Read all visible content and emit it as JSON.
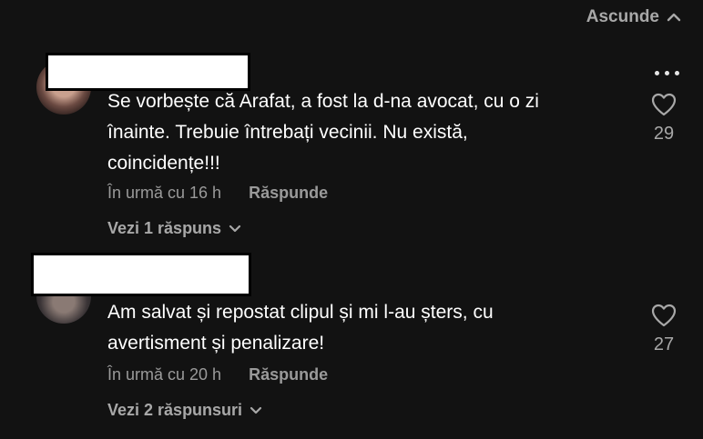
{
  "header": {
    "hide_label": "Ascunde",
    "hide_icon": "chevron-up-icon"
  },
  "comments": [
    {
      "text_lines": [
        "Se vorbește că Arafat, a fost la d-na avocat, cu o zi",
        "înainte. Trebuie întrebați vecinii. Nu există,",
        "coincidențe!!!"
      ],
      "time": "În urmă cu 16 h",
      "reply_label": "Răspunde",
      "replies_label": "Vezi 1 răspuns",
      "likes": "29",
      "has_more_menu": true
    },
    {
      "text_lines": [
        "Am salvat și repostat clipul și mi l-au șters, cu",
        "avertisment și penalizare!"
      ],
      "time": "În urmă cu 20 h",
      "reply_label": "Răspunde",
      "replies_label": "Vezi 2 răspunsuri",
      "likes": "27",
      "has_more_menu": false
    }
  ],
  "colors": {
    "background": "#121212",
    "text_primary": "#ffffff",
    "text_secondary": "#a8a8a8",
    "redaction_box": "#ffffff"
  }
}
